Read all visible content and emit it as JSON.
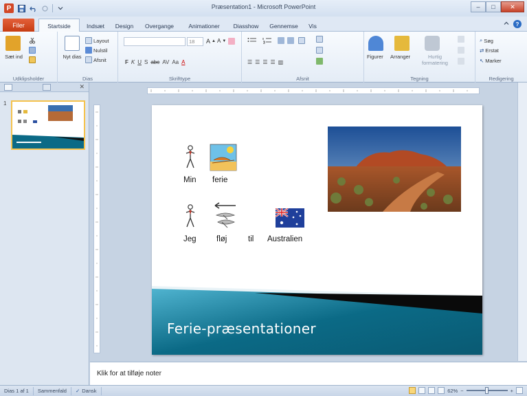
{
  "window": {
    "title": "Præsentation1 - Microsoft PowerPoint",
    "minimize": "–",
    "maximize": "□",
    "close": "✕"
  },
  "qat": {
    "app_icon_letter": "P"
  },
  "tabs": {
    "file": "Filer",
    "items": [
      "Startside",
      "Indsæt",
      "Design",
      "Overgange",
      "Animationer",
      "Diasshow",
      "Gennemse",
      "Vis"
    ],
    "active_index": 0
  },
  "ribbon": {
    "clipboard": {
      "label": "Udklipsholder",
      "paste": "Sæt ind",
      "icon_colors": [
        "#e2a32a",
        "#5b8bd6"
      ]
    },
    "slides": {
      "label": "Dias",
      "new_slide": "Nyt dias",
      "layout": "Layout",
      "reset": "Nulstil",
      "section": "Afsnit"
    },
    "font": {
      "label": "Skrifttype",
      "size_value": "18",
      "buttons": [
        "F",
        "K",
        "U",
        "S",
        "abc",
        "AV",
        "Aa",
        "A"
      ]
    },
    "paragraph": {
      "label": "Afsnit"
    },
    "drawing": {
      "label": "Tegning",
      "shapes": "Figurer",
      "arrange": "Arranger",
      "quick_styles": "Hurtig formatering"
    },
    "editing": {
      "label": "Redigering",
      "find": "Søg",
      "replace": "Erstat",
      "select": "Marker"
    }
  },
  "left_panel": {
    "slide_number": "1"
  },
  "slide": {
    "words_row1": [
      "Min",
      "ferie"
    ],
    "words_row2": [
      "Jeg",
      "fløj",
      "til",
      "Australien"
    ],
    "title": "Ferie-præsentationer",
    "band_colors": {
      "dark": "#0b6a86",
      "light": "#4fb3cf",
      "black": "#0a0a0a",
      "stripe": "#e9f3f7"
    }
  },
  "notes": {
    "placeholder": "Klik for at tilføje noter"
  },
  "status": {
    "slide_info": "Dias 1 af 1",
    "theme": "Sammenfald",
    "language": "Dansk",
    "zoom": "62%",
    "zoom_minus": "−",
    "zoom_plus": "+",
    "zoom_fraction": 0.62
  }
}
